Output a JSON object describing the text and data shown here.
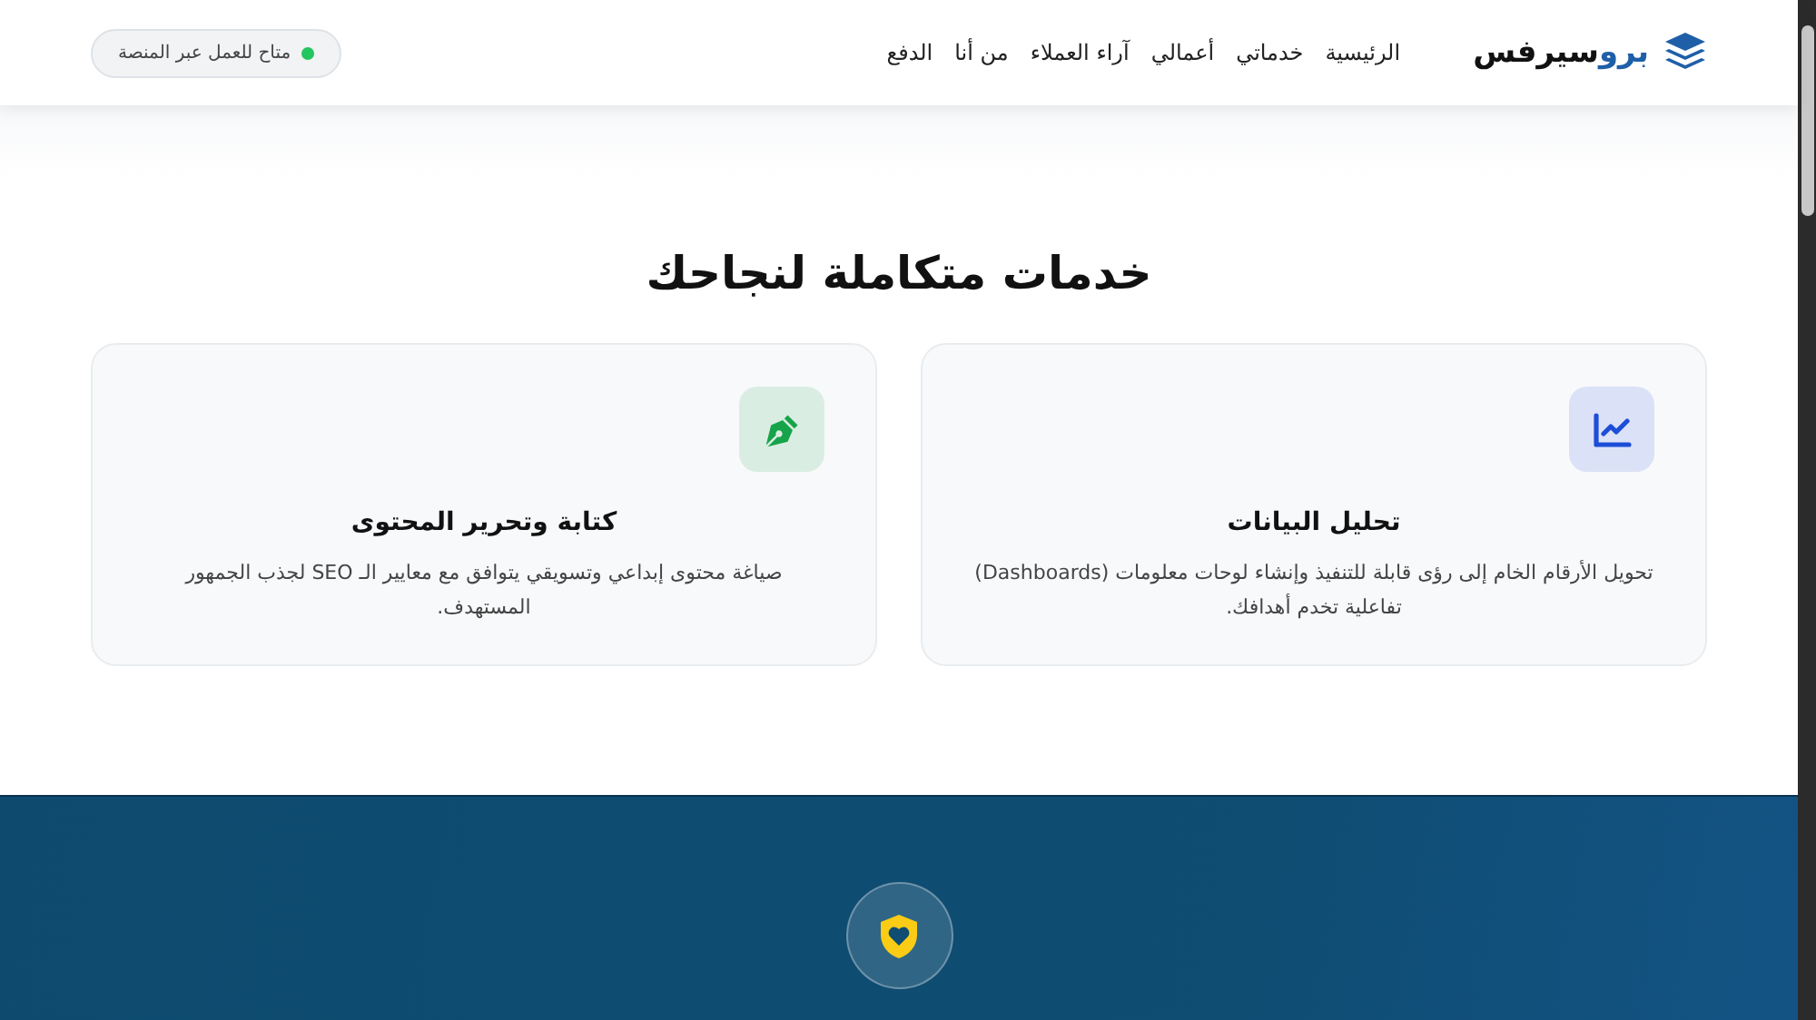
{
  "header": {
    "logo": {
      "part_1": "برو",
      "part_2": "سيرفس"
    },
    "nav": [
      {
        "label": "الرئيسية"
      },
      {
        "label": "خدماتي"
      },
      {
        "label": "أعمالي"
      },
      {
        "label": "آراء العملاء"
      },
      {
        "label": "من أنا"
      },
      {
        "label": "الدفع"
      }
    ],
    "status_badge": {
      "label": "متاح للعمل عبر المنصة",
      "color": "#22c55e"
    }
  },
  "services": {
    "title": "خدمات متكاملة لنجاحك",
    "cards": [
      {
        "kind": "chart",
        "title": "تحليل البيانات",
        "description": "تحويل الأرقام الخام إلى رؤى قابلة للتنفيذ وإنشاء لوحات معلومات (Dashboards) تفاعلية تخدم أهدافك.",
        "color": "#1d4ed8"
      },
      {
        "kind": "pen",
        "title": "كتابة وتحرير المحتوى",
        "description": "صياغة محتوى إبداعي وتسويقي يتوافق مع معايير الـ SEO لجذب الجمهور المستهدف.",
        "color": "#16a34a"
      }
    ]
  }
}
